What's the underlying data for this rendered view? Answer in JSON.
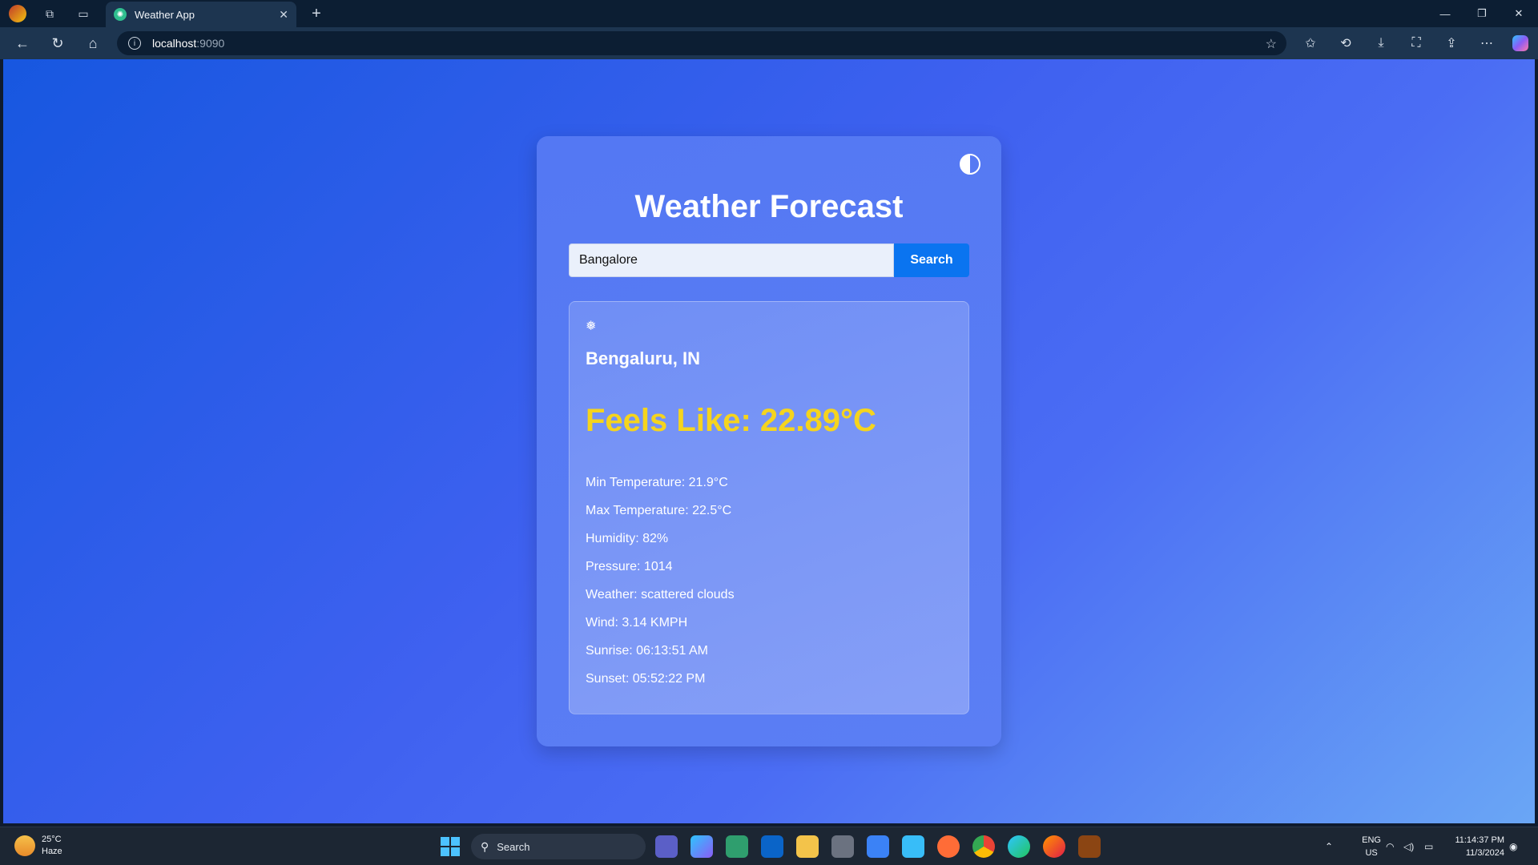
{
  "browser": {
    "tab_title": "Weather App",
    "url_host": "localhost",
    "url_port": ":9090"
  },
  "app": {
    "title": "Weather Forecast",
    "search": {
      "value": "Bangalore",
      "button_label": "Search"
    },
    "result": {
      "weather_icon": "❅",
      "city": "Bengaluru, IN",
      "feels_like": "Feels Like: 22.89°C",
      "stats": [
        "Min Temperature: 21.9°C",
        "Max Temperature: 22.5°C",
        "Humidity: 82%",
        "Pressure: 1014",
        "Weather: scattered clouds",
        "Wind: 3.14 KMPH",
        "Sunrise: 06:13:51 AM",
        "Sunset: 05:52:22 PM"
      ]
    }
  },
  "taskbar": {
    "weather_temp": "25°C",
    "weather_cond": "Haze",
    "search_label": "Search",
    "lang_line1": "ENG",
    "lang_line2": "US",
    "time": "11:14:37 PM",
    "date": "11/3/2024"
  }
}
